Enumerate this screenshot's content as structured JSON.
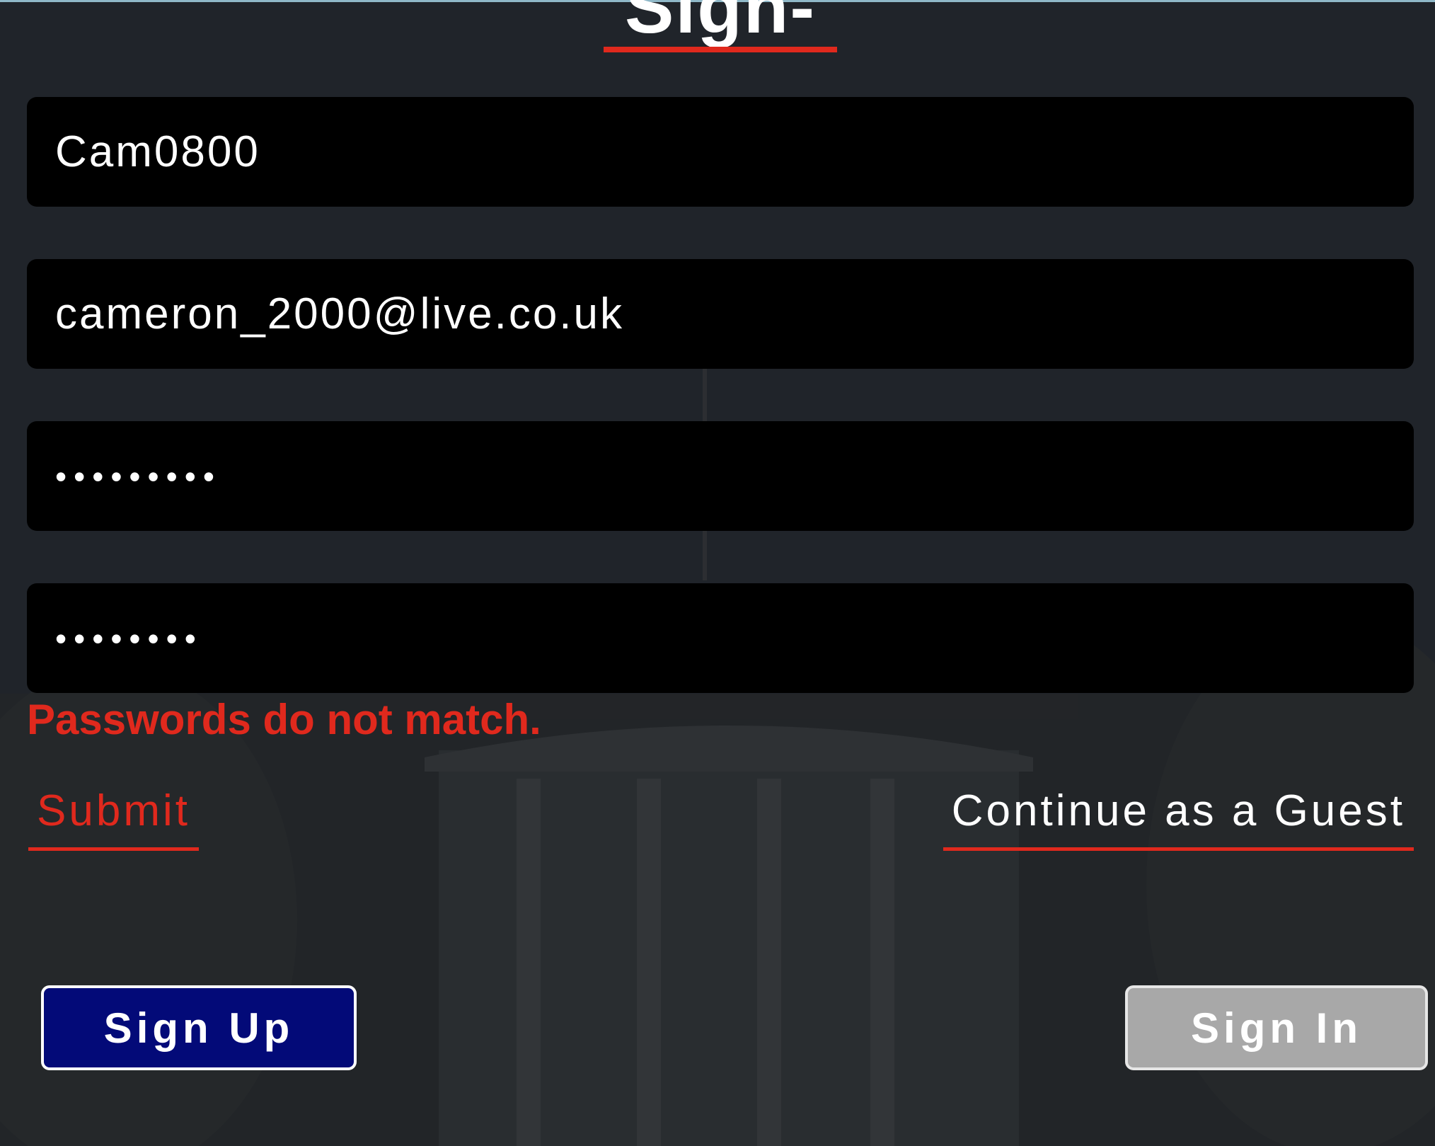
{
  "page": {
    "title": "Sign-Up",
    "accent_color": "#e0291d",
    "background_color": "#20242a"
  },
  "form": {
    "username_value": "Cam0800",
    "email_value": "cameron_2000@live.co.uk",
    "password_value": "•••••••••",
    "confirm_password_value": "••••••••",
    "error_message": "Passwords do not match."
  },
  "actions": {
    "submit_label": "Submit",
    "guest_label": "Continue as a Guest"
  },
  "buttons": {
    "signup_label": "Sign Up",
    "signup_color": "#030a78",
    "signin_label": "Sign In",
    "signin_color": "#a8a8a8"
  }
}
